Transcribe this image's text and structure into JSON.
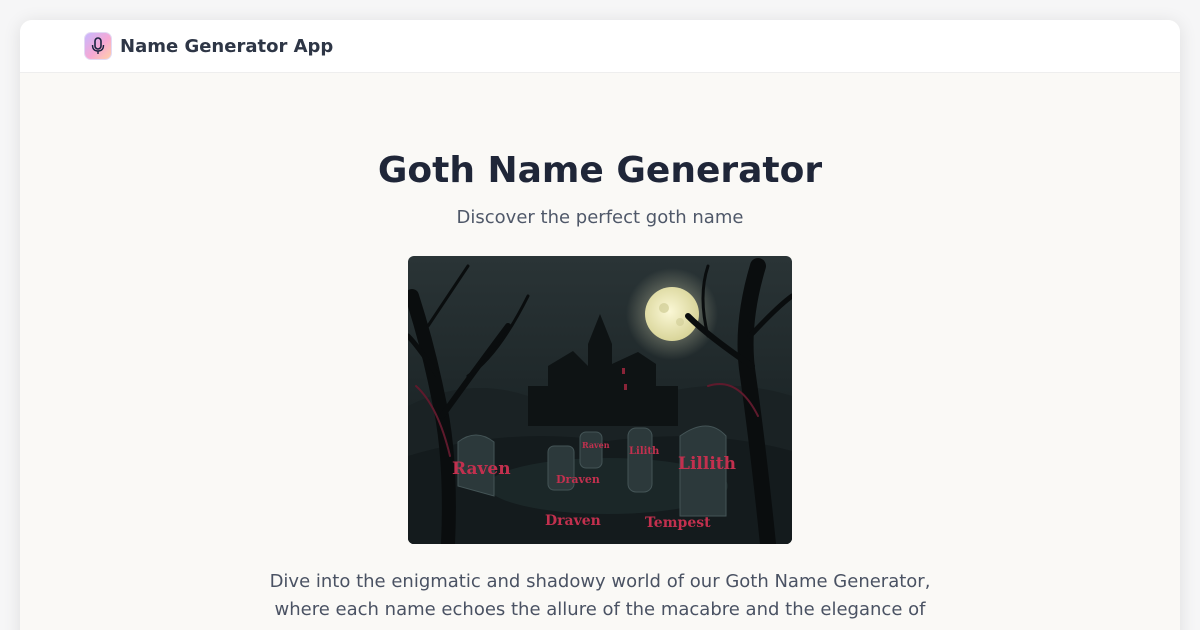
{
  "header": {
    "logo_icon": "microphone-icon",
    "app_name": "Name Generator App"
  },
  "hero": {
    "title": "Goth Name Generator",
    "subtitle": "Discover the perfect goth name",
    "image": {
      "tombstone_names": [
        "Raven",
        "Draven",
        "Lillith",
        "Lilith",
        "Raven",
        "Draven",
        "Tempest"
      ]
    },
    "description": "Dive into the enigmatic and shadowy world of our Goth Name Generator, where each name echoes the allure of the macabre and the elegance of"
  },
  "colors": {
    "accent_red": "#c2304e",
    "title_dark": "#1f2638",
    "moon": "#e8e6b9"
  }
}
